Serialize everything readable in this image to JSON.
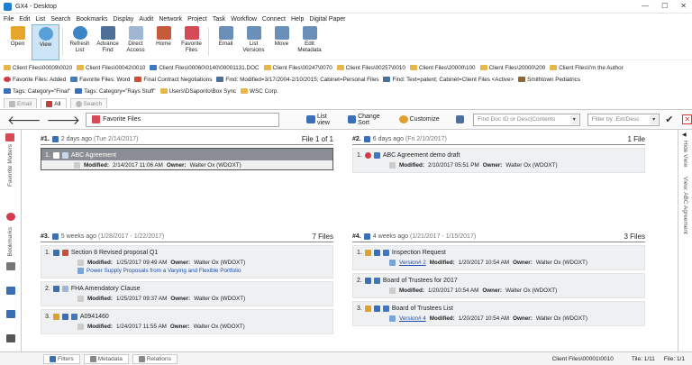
{
  "window": {
    "title": "GX4 - Desktop",
    "minimize": "—",
    "maximize": "☐",
    "close": "✕"
  },
  "menu": [
    "File",
    "Edit",
    "List",
    "Search",
    "Bookmarks",
    "Display",
    "Audit",
    "Network",
    "Project",
    "Task",
    "Workflow",
    "Connect",
    "Help",
    "Digital Paper"
  ],
  "ribbon": [
    {
      "label": "Open",
      "icon": "open-folder-icon",
      "color": "#e8a52b"
    },
    {
      "label": "View",
      "icon": "magnifier-icon",
      "color": "#5aa0d8",
      "active": true
    },
    {
      "label": "Refresh List",
      "icon": "refresh-icon",
      "color": "#3d86c6"
    },
    {
      "label": "Advance Find",
      "icon": "binoculars-icon",
      "color": "#4d6f98"
    },
    {
      "label": "Direct Access",
      "icon": "document-icon",
      "color": "#9fb7d3"
    },
    {
      "label": "Home",
      "icon": "home-icon",
      "color": "#c75a3a"
    },
    {
      "label": "Favorite Files",
      "icon": "heart-file-icon",
      "color": "#d64a55"
    },
    {
      "label": "Email",
      "icon": "email-icon",
      "color": "#6a8fb8"
    },
    {
      "label": "List Versions",
      "icon": "versions-icon",
      "color": "#6a8fb8"
    },
    {
      "label": "Move",
      "icon": "move-icon",
      "color": "#6a8fb8"
    },
    {
      "label": "Edit Metadata",
      "icon": "edit-metadata-icon",
      "color": "#6a8fb8"
    }
  ],
  "favorites_row1": [
    "Client Files\\00009\\0020",
    "Client Files\\00042\\0010",
    "Client Files\\00060\\0140\\00001131.DOC",
    "Client Files\\00247\\0070",
    "Client Files\\00257\\0010",
    "Client Files\\20000\\100",
    "Client Files\\20000\\200",
    "Client Files\\I'm the Author"
  ],
  "favorites_row2": [
    "Favorite Files: Added",
    "Favorite Files: Word",
    "Final Contract Negotiations",
    "Find: Modified=3/17/2004-2/10/2015; Cabinet=Personal Files",
    "Find: Text=patent; Cabinet=Client Files <Active>",
    "Smithtown Pediatrics"
  ],
  "favorites_row3": [
    "Tags: Category=\"Final\"",
    "Tags: Category=\"Rays Stuff\"",
    "Users\\DSaporito\\Box Sync",
    "WSC Corp."
  ],
  "tabs": [
    "Email",
    "All",
    "Search"
  ],
  "toolbar": {
    "back": "🡐",
    "forward": "🡒",
    "current": "Favorite Files",
    "list_view": "List view",
    "change_sort": "Change Sort",
    "customize": "Customize",
    "find_placeholder": "Find Doc ID or Desc|Contents",
    "filter_placeholder": "Filter by .Ext/Desc"
  },
  "left_rail": {
    "favorite_matters": "Favorite Matters",
    "bookmarks": "Bookmarks"
  },
  "right_rail": {
    "hide_view": "Hide View",
    "view_doc": "View: ABC Agreement"
  },
  "groups": [
    {
      "num": "#1.",
      "ago": "2 days ago",
      "date": "(Tue 2/14/2017)",
      "count": "File 1 of 1",
      "items": [
        {
          "idx": "1.",
          "title": "ABC Agreement",
          "modified": "2/14/2017 11:06 AM",
          "owner": "Walter Ox (WDOXT)",
          "selected": true
        }
      ]
    },
    {
      "num": "#2.",
      "ago": "6 days ago",
      "date": "(Fri 2/10/2017)",
      "count": "1 File",
      "items": [
        {
          "idx": "1.",
          "title": "ABC Agreement demo draft",
          "modified": "2/10/2017 05:51 PM",
          "owner": "Walter Ox (WDOXT)"
        }
      ]
    },
    {
      "num": "#3.",
      "ago": "5 weeks ago",
      "date": "(1/28/2017 - 1/22/2017)",
      "count": "7 Files",
      "items": [
        {
          "idx": "1.",
          "title": "Section 8 Revised proposal Q1",
          "modified": "1/25/2017 09:49 AM",
          "owner": "Walter Ox (WDOXT)",
          "sub": "Power Supply Proposals from a Varying and Flexible Portfolio"
        },
        {
          "idx": "2.",
          "title": "FHA Amendatory Clause",
          "modified": "1/25/2017 09:37 AM",
          "owner": "Walter Ox (WDOXT)"
        },
        {
          "idx": "3.",
          "title": "A0941460",
          "modified": "1/24/2017 11:55 AM",
          "owner": "Walter Ox (WDOXT)"
        }
      ]
    },
    {
      "num": "#4.",
      "ago": "4 weeks ago",
      "date": "(1/21/2017 - 1/15/2017)",
      "count": "3 Files",
      "items": [
        {
          "idx": "1.",
          "title": "Inspection Request",
          "version": "Version# 2",
          "modified": "1/20/2017 10:54 AM",
          "owner": "Walter Ox (WDOXT)"
        },
        {
          "idx": "2.",
          "title": "Board of Trustees for 2017",
          "modified": "1/20/2017 10:54 AM",
          "owner": "Walter Ox (WDOXT)"
        },
        {
          "idx": "3.",
          "title": "Board of Trustees List",
          "version": "Version# 4",
          "modified": "1/20/2017 10:54 AM",
          "owner": "Walter Ox (WDOXT)"
        }
      ]
    }
  ],
  "labels": {
    "modified": "Modified:",
    "owner": "Owner:"
  },
  "status": {
    "tabs": [
      "Filters",
      "Metadata",
      "Relations"
    ],
    "path": "Client Files\\00001\\0010",
    "tile": "Tile: 1/11",
    "file": "File: 1/1"
  }
}
